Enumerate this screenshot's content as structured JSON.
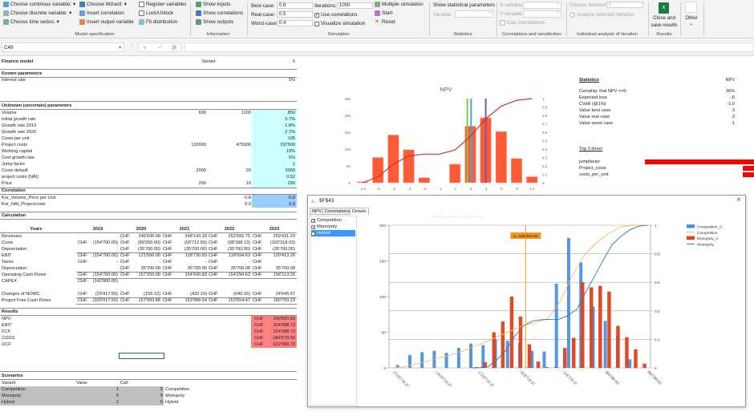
{
  "ribbon": {
    "model_spec": {
      "label": "Model specification",
      "items": [
        "Choose continous variable:",
        "Choose discrete variable:",
        "Choose time series:",
        "Choose Wizard:",
        "Insert correlation",
        "Insert output variable",
        "Register variables",
        "Lock/Unlock",
        "Fit distribution"
      ]
    },
    "information": {
      "label": "Information",
      "items": [
        "Show inputs",
        "Show correlations",
        "Show outputs"
      ]
    },
    "simulation": {
      "label": "Simulation",
      "best_label": "Best-case:",
      "best": "0.6",
      "real_label": "Real-case:",
      "real": "0.5",
      "worst_label": "Worst-case:",
      "worst": "0.4",
      "iter_label": "Iterations:",
      "iterations": "1000",
      "use_corr": "Use correlations",
      "use_corr_checked": true,
      "visualize": "Visualize simulation",
      "visualize_checked": false,
      "multiple": "Multiple simulation",
      "start": "Start",
      "reset": "Reset"
    },
    "statistics": {
      "label": "Statistics",
      "show": "Show statistical parameters",
      "variable": "Variable"
    },
    "correlations": {
      "label": "Correlations and sensitivities",
      "x": "X-variable",
      "y": "Y-variable",
      "calc": "Calc correlations"
    },
    "individual": {
      "label": "Individual analysis of iteration",
      "choose": "Choose iteration:",
      "iteration": "0",
      "analyze": "Analyze selected iteration"
    },
    "results": {
      "label": "Results",
      "close1": "Close and",
      "close2": "save results"
    },
    "other": {
      "label": "Other"
    }
  },
  "formula_bar": {
    "name_box": "C49",
    "formula": ""
  },
  "sheet": {
    "title": "Finance model",
    "variant_label": "Variant",
    "variant": "5",
    "known_heading": "Known parameters",
    "interest_label": "Interest rate",
    "interest": "5%",
    "unknown_heading": "Unknown (uncertain) parameters",
    "unknown": [
      [
        "Volume",
        "600",
        "1100",
        "850"
      ],
      [
        "Initial growth rate",
        "",
        "",
        "0.7%"
      ],
      [
        "Growth rate 2019",
        "",
        "",
        "1.8%"
      ],
      [
        "Growth rate 2020",
        "",
        "",
        "2.7%"
      ],
      [
        "Costs per unit",
        "",
        "",
        "105"
      ],
      [
        "Project costs",
        "120000",
        "475000",
        "297500"
      ],
      [
        "Working capital",
        "",
        "",
        "10%"
      ],
      [
        "Cost growth rate",
        "",
        "",
        "5%"
      ],
      [
        "Jump factor",
        "",
        "",
        "1"
      ],
      [
        "Costs default",
        "2000",
        "20",
        "2000"
      ],
      [
        "project costs (NAI)",
        "",
        "",
        "0.52"
      ],
      [
        "Price",
        "290",
        "10",
        "290"
      ]
    ],
    "corr_heading": "Correlation",
    "corr": [
      [
        "Kor_Volume_Price per Unit",
        "",
        "-0.8",
        "-0.8"
      ],
      [
        "Kor_NAI_Projectcosts",
        "",
        "0.9",
        "0.9"
      ]
    ],
    "calc_heading": "Calculation",
    "years_label": "Years",
    "years": [
      "2019",
      "2020",
      "2021",
      "2022",
      "2023"
    ],
    "calc": [
      [
        "Revenues",
        "",
        "",
        "CHF",
        "246'500.00",
        "CHF",
        "248'143.33",
        "CHF",
        "252'692.75",
        "CHF",
        "259'431.29"
      ],
      [
        "Costs",
        "CHF",
        "(154'700.00)",
        "CHF",
        "(89'250.00)",
        "CHF",
        "(93'712.50)",
        "CHF",
        "(98'398.13)",
        "CHF",
        "(103'318.03)"
      ],
      [
        "Depreciation",
        "",
        "",
        "CHF",
        "(35'700.00)",
        "CHF",
        "(35'700.00)",
        "CHF",
        "(35'700.00)",
        "CHF",
        "(35'700.00)"
      ],
      [
        "EBIT",
        "CHF",
        "(154'700.00)",
        "CHF",
        "121'550.00",
        "CHF",
        "118'730.83",
        "CHF",
        "118'594.63",
        "CHF",
        "120'413.26"
      ],
      [
        "Taxes",
        "CHF",
        "-",
        "CHF",
        "-",
        "CHF",
        "-",
        "CHF",
        "-",
        "CHF",
        "-"
      ],
      [
        "Depreciation",
        "",
        "",
        "CHF",
        "35'700.00",
        "CHF",
        "35'700.00",
        "CHF",
        "35'700.00",
        "CHF",
        "35'700.00"
      ],
      [
        "Operating Cash Flows",
        "CHF",
        "(154'700.00)",
        "CHF",
        "157'250.00",
        "CHF",
        "154'430.83",
        "CHF",
        "154'294.63",
        "CHF",
        "156'113.26"
      ],
      [
        "CAPEX",
        "CHF",
        "(142'800.00)",
        "",
        "",
        "",
        "",
        "",
        "",
        "",
        ""
      ],
      [
        "",
        "",
        "",
        "",
        "",
        "",
        "",
        "",
        "",
        "",
        ""
      ],
      [
        "Changes of NOWC",
        "CHF",
        "(23'417.50)",
        "CHF",
        "(156.12)",
        "CHF",
        "(432.19)",
        "CHF",
        "(640.16)",
        "CHF",
        "24'645.97"
      ],
      [
        "Project Free Cash Flows",
        "CHF",
        "(320'917.50)",
        "CHF",
        "157'093.88",
        "CHF",
        "153'998.64",
        "CHF",
        "153'654.47",
        "CHF",
        "180'759.23"
      ]
    ],
    "results_heading": "Results",
    "results": [
      [
        "NPV",
        "CHF",
        "249'820.60"
      ],
      [
        "EBIT",
        "CHF",
        "324'588.72"
      ],
      [
        "FCF",
        "CHF",
        "324'588.72"
      ],
      [
        "COGS",
        "CHF",
        "-384'678.66"
      ],
      [
        "OCF",
        "CHF",
        "622'088.72"
      ]
    ],
    "scen_heading": "Scenarios",
    "scen_cols": [
      "Variant",
      "Value",
      "Cell"
    ],
    "scenarios": [
      [
        "Competition",
        "1",
        "5",
        "Competition"
      ],
      [
        "Monopoly",
        "5",
        "5",
        "Monopoly"
      ],
      [
        "Hybrid",
        "2",
        "5",
        "Hybrid"
      ]
    ]
  },
  "stats": {
    "heading": "Statistics",
    "col": "NPV",
    "rows": [
      [
        "Certainty, that NPV <=0",
        "36%"
      ],
      [
        "Expected loss",
        "-.6"
      ],
      [
        "CVaR (@1%)",
        "-1.0"
      ],
      [
        "Value best case",
        ".3"
      ],
      [
        "Value real case",
        ".2"
      ],
      [
        "Value worst case",
        ".1"
      ]
    ],
    "drivers_heading": "Top 3 driver",
    "drivers": [
      {
        "name": "jumpfactor",
        "value": 1.0
      },
      {
        "name": "Project_costs",
        "value": 0.1
      },
      {
        "name": "costs_per_unit",
        "value": 0.1
      }
    ],
    "driver_color": "#ff0000"
  },
  "chart_data": [
    {
      "type": "bar",
      "title": "NPV",
      "categories": [
        "-1.0",
        "-.8",
        "-.6",
        "-.4",
        "-.3",
        "-.1",
        ".1",
        ".3",
        ".4",
        ".6",
        ".8",
        "1.0"
      ],
      "values": [
        3,
        75,
        142,
        98,
        15,
        0,
        55,
        168,
        193,
        152,
        72,
        18
      ],
      "cumulative": [
        0,
        0.07,
        0.22,
        0.32,
        0.34,
        0.34,
        0.39,
        0.55,
        0.76,
        0.91,
        0.98,
        1.0
      ],
      "ylim": [
        0,
        250
      ],
      "yticks": [
        "0",
        "50",
        "100",
        "150",
        "200",
        "250"
      ],
      "y2lim": [
        0,
        1
      ],
      "y2ticks": [
        "0",
        "0.1",
        "0.2",
        "0.3",
        "0.4",
        "0.5",
        "0.6",
        "0.7",
        "0.8",
        "0.9",
        "1"
      ],
      "bar_color": "#ff5a36",
      "line_color": "#c0392b",
      "markers": [
        {
          "category_position": 6.8,
          "color": "#8dc63f"
        },
        {
          "category_position": 7.05,
          "color": "#3fa9d8"
        },
        {
          "category_position": 8.0,
          "color": "#7a5aa8"
        }
      ]
    },
    {
      "type": "bar",
      "title": "Project Free Cash Flows",
      "xlim": [
        -2115719.37,
        884280.63
      ],
      "xticks": [
        "-2'115'719.37",
        "-1'615'719.37",
        "-1'115'719.37",
        "-615'719.37",
        "-115'719.37",
        "384'280.63",
        "884'280.63"
      ],
      "ylim": [
        0,
        200
      ],
      "yticks": [
        "0",
        "50",
        "100",
        "150",
        "200"
      ],
      "y2ticks": [
        "0",
        "0.2",
        "0.4",
        "0.6",
        "0.8",
        "1"
      ],
      "series": [
        {
          "name": "Competition_0",
          "color": "#4a90e2",
          "x": [
            -2053000,
            -1909000,
            -1765000,
            -1622000,
            -1478000,
            -1334000,
            -1191000,
            -1047000,
            -903000,
            -760000,
            -616000,
            -472000,
            -328000,
            -185000,
            -41000,
            103000,
            247000,
            390000,
            534000,
            678000
          ],
          "values": [
            4,
            18,
            22,
            24,
            21,
            28,
            34,
            32,
            40,
            38,
            35,
            24,
            23,
            118,
            182,
            148,
            86,
            66,
            45,
            12
          ]
        },
        {
          "name": "Monopoly_1",
          "color": "#e2401a",
          "x": [
            -1130000,
            -1026000,
            -922000,
            -818000,
            -713000,
            -609000,
            -505000,
            -401000,
            -297000,
            -193000,
            -88000,
            16000,
            120000,
            224000,
            328000,
            433000,
            537000,
            641000,
            745000,
            849000
          ],
          "values": [
            1,
            8,
            50,
            65,
            100,
            72,
            33,
            9,
            1,
            1,
            28,
            42,
            120,
            113,
            115,
            107,
            59,
            43,
            26,
            6
          ]
        }
      ],
      "lines": [
        {
          "name": "Competition",
          "color": "#f9b95c"
        },
        {
          "name": "Monopoly",
          "color": "#2b7fa8"
        }
      ],
      "cursor": {
        "x": -546403.93,
        "label": "x=-546'403.93",
        "color": "#f7941d"
      }
    }
  ],
  "dialog": {
    "title": "$F$43",
    "tabs": [
      "NPV",
      "Correlations",
      "Details"
    ],
    "active_tab": "Details",
    "list": [
      {
        "label": "Competition",
        "checked": true
      },
      {
        "label": "Monopoly",
        "checked": true
      },
      {
        "label": "Hybrid",
        "checked": false,
        "selected": true
      }
    ]
  }
}
